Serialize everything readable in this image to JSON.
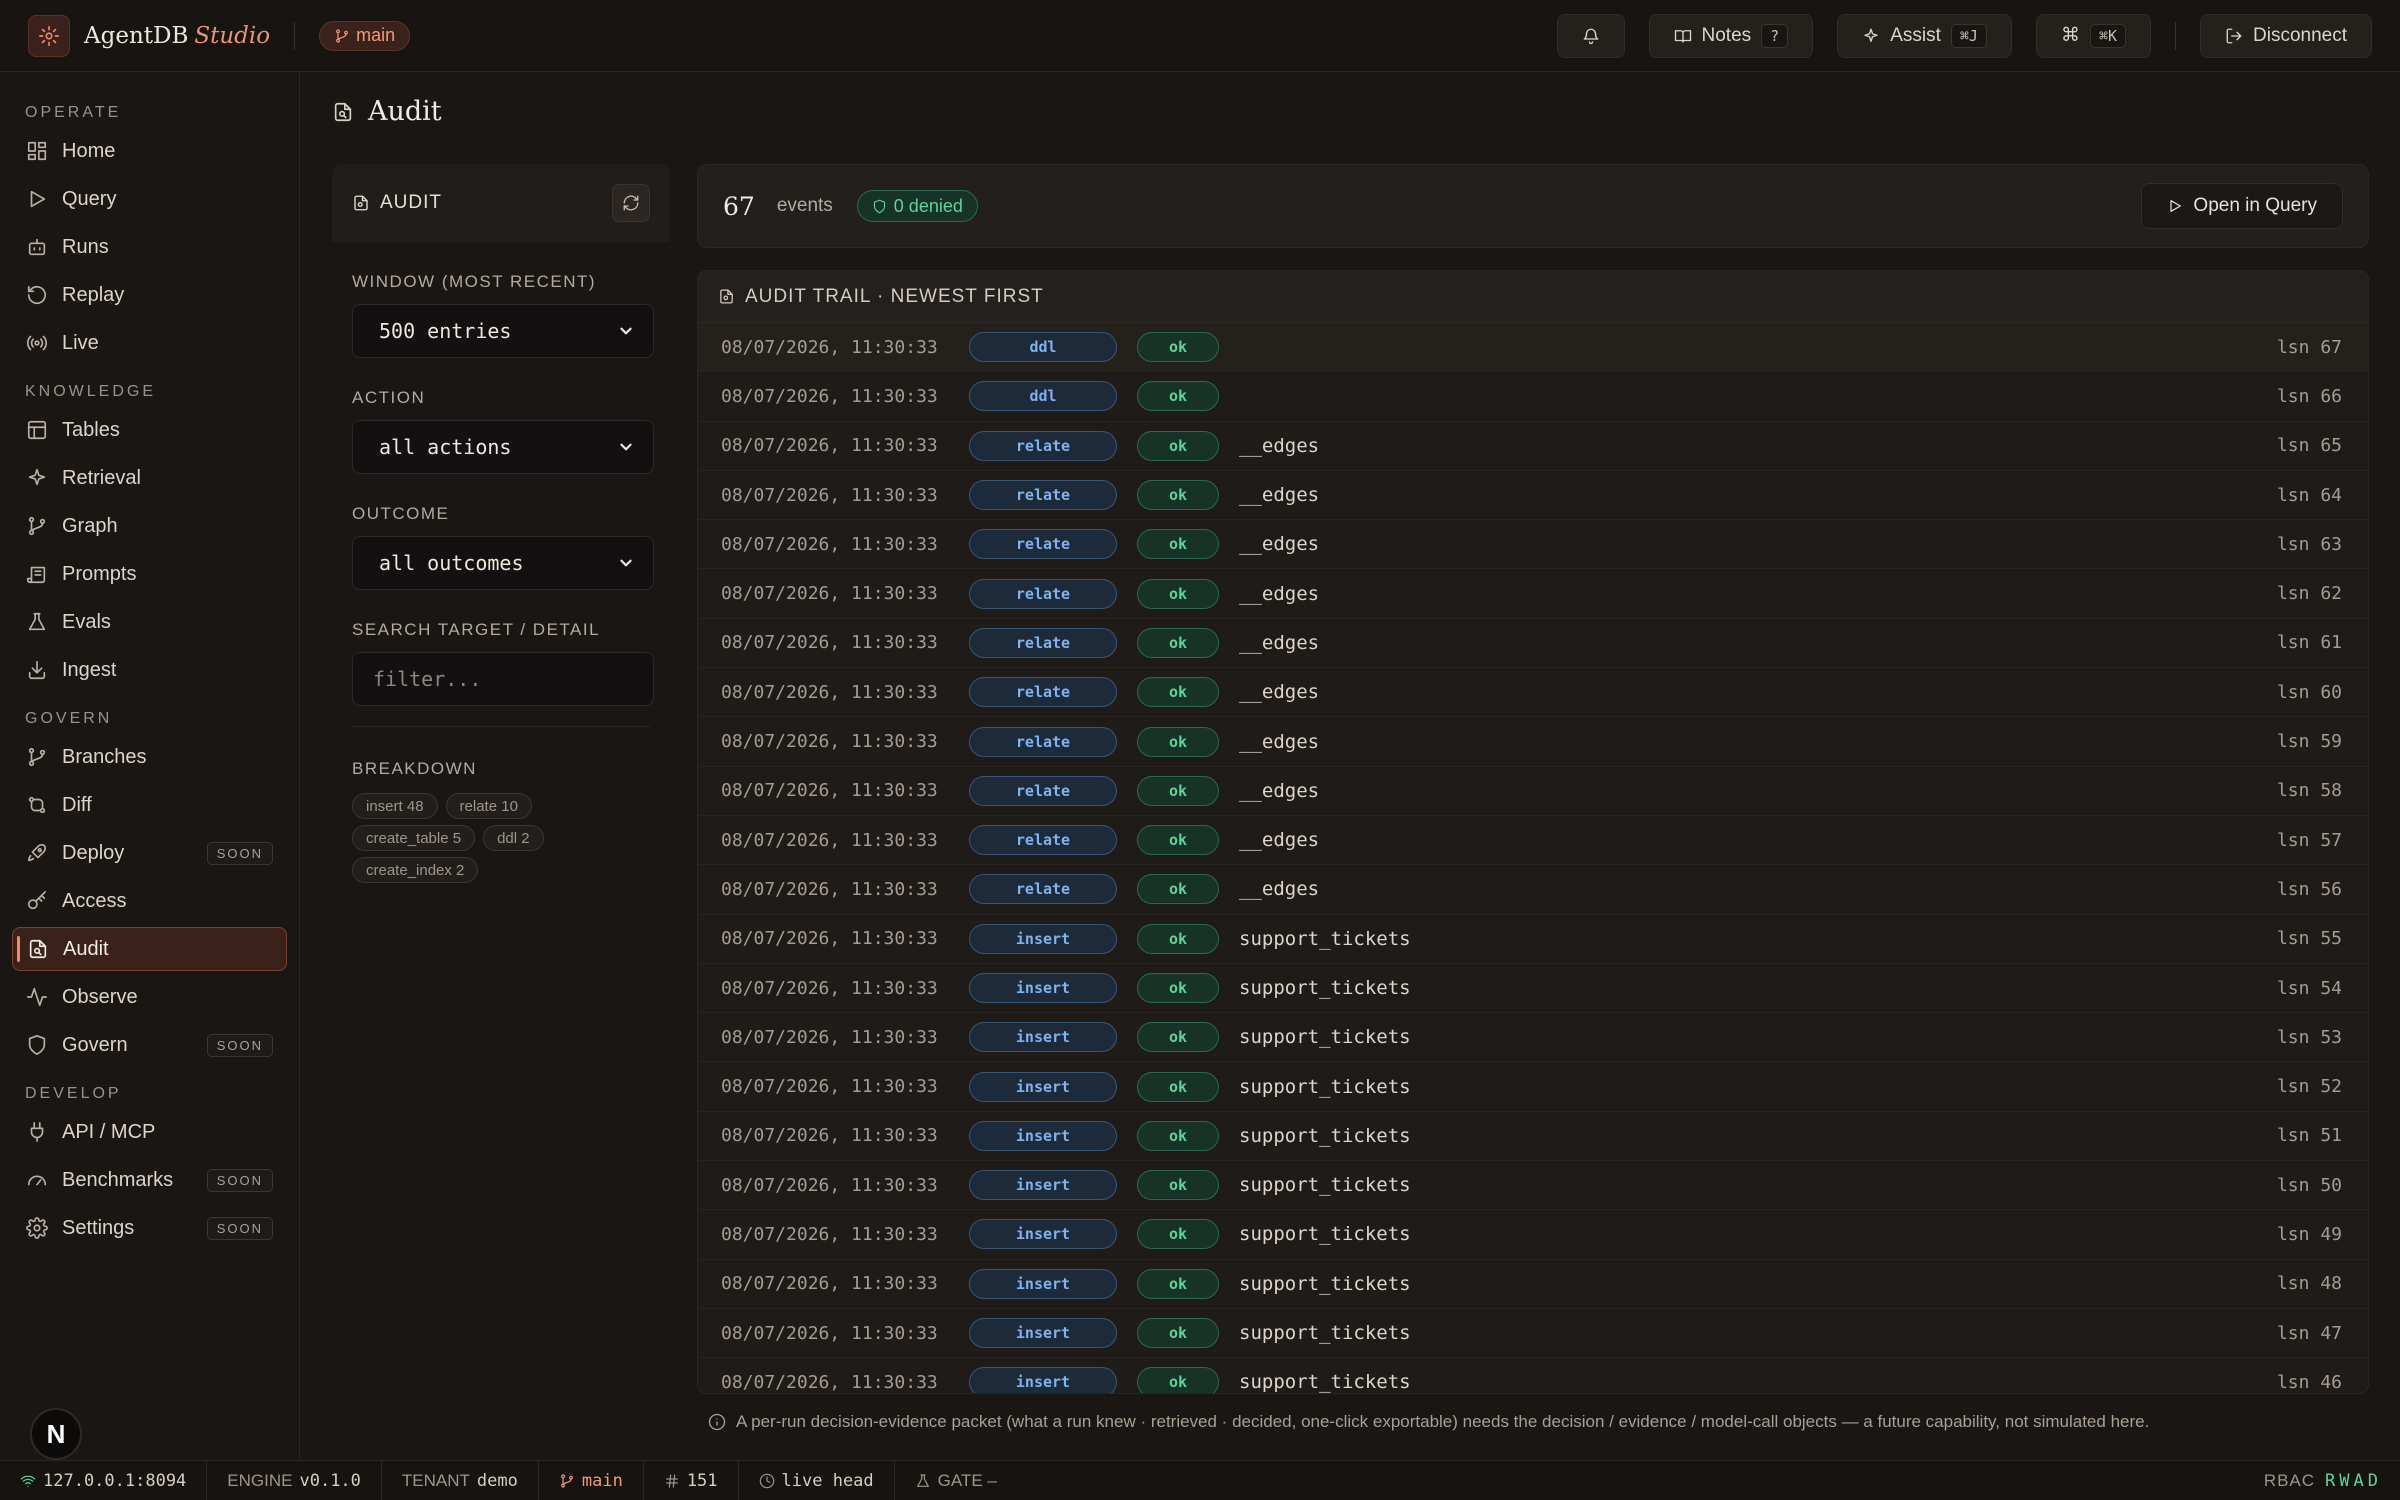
{
  "app": {
    "brand": "AgentDB",
    "brand_suffix": "Studio",
    "branch": "main"
  },
  "topbar": {
    "notes_label": "Notes",
    "notes_key": "?",
    "assist_label": "Assist",
    "assist_key": "⌘J",
    "cmd_symbol": "⌘",
    "cmd_key": "⌘K",
    "disconnect_label": "Disconnect"
  },
  "sidebar": {
    "sections": {
      "operate": "OPERATE",
      "knowledge": "KNOWLEDGE",
      "govern": "GOVERN",
      "develop": "DEVELOP"
    },
    "items": {
      "home": "Home",
      "query": "Query",
      "runs": "Runs",
      "replay": "Replay",
      "live": "Live",
      "tables": "Tables",
      "retrieval": "Retrieval",
      "graph": "Graph",
      "prompts": "Prompts",
      "evals": "Evals",
      "ingest": "Ingest",
      "branches": "Branches",
      "diff": "Diff",
      "deploy": "Deploy",
      "access": "Access",
      "audit": "Audit",
      "observe": "Observe",
      "govern": "Govern",
      "api": "API / MCP",
      "benchmarks": "Benchmarks",
      "settings": "Settings"
    },
    "soon_label": "SOON",
    "avatar_letter": "N"
  },
  "page": {
    "title": "Audit"
  },
  "filters": {
    "panel_title": "AUDIT",
    "window_label": "WINDOW (MOST RECENT)",
    "window_value": "500 entries",
    "action_label": "ACTION",
    "action_value": "all actions",
    "outcome_label": "OUTCOME",
    "outcome_value": "all outcomes",
    "search_label": "SEARCH TARGET / DETAIL",
    "search_placeholder": "filter...",
    "breakdown_label": "BREAKDOWN",
    "breakdown": [
      "insert 48",
      "relate 10",
      "create_table 5",
      "ddl 2",
      "create_index 2"
    ]
  },
  "stats": {
    "count": "67",
    "count_label": "events",
    "denied": "0 denied",
    "open_query": "Open in Query"
  },
  "trail": {
    "title": "AUDIT TRAIL · NEWEST FIRST",
    "rows": [
      {
        "time": "08/07/2026, 11:30:33",
        "action": "ddl",
        "outcome": "ok",
        "target": "",
        "lsn": "lsn 67"
      },
      {
        "time": "08/07/2026, 11:30:33",
        "action": "ddl",
        "outcome": "ok",
        "target": "",
        "lsn": "lsn 66"
      },
      {
        "time": "08/07/2026, 11:30:33",
        "action": "relate",
        "outcome": "ok",
        "target": "__edges",
        "lsn": "lsn 65"
      },
      {
        "time": "08/07/2026, 11:30:33",
        "action": "relate",
        "outcome": "ok",
        "target": "__edges",
        "lsn": "lsn 64"
      },
      {
        "time": "08/07/2026, 11:30:33",
        "action": "relate",
        "outcome": "ok",
        "target": "__edges",
        "lsn": "lsn 63"
      },
      {
        "time": "08/07/2026, 11:30:33",
        "action": "relate",
        "outcome": "ok",
        "target": "__edges",
        "lsn": "lsn 62"
      },
      {
        "time": "08/07/2026, 11:30:33",
        "action": "relate",
        "outcome": "ok",
        "target": "__edges",
        "lsn": "lsn 61"
      },
      {
        "time": "08/07/2026, 11:30:33",
        "action": "relate",
        "outcome": "ok",
        "target": "__edges",
        "lsn": "lsn 60"
      },
      {
        "time": "08/07/2026, 11:30:33",
        "action": "relate",
        "outcome": "ok",
        "target": "__edges",
        "lsn": "lsn 59"
      },
      {
        "time": "08/07/2026, 11:30:33",
        "action": "relate",
        "outcome": "ok",
        "target": "__edges",
        "lsn": "lsn 58"
      },
      {
        "time": "08/07/2026, 11:30:33",
        "action": "relate",
        "outcome": "ok",
        "target": "__edges",
        "lsn": "lsn 57"
      },
      {
        "time": "08/07/2026, 11:30:33",
        "action": "relate",
        "outcome": "ok",
        "target": "__edges",
        "lsn": "lsn 56"
      },
      {
        "time": "08/07/2026, 11:30:33",
        "action": "insert",
        "outcome": "ok",
        "target": "support_tickets",
        "lsn": "lsn 55"
      },
      {
        "time": "08/07/2026, 11:30:33",
        "action": "insert",
        "outcome": "ok",
        "target": "support_tickets",
        "lsn": "lsn 54"
      },
      {
        "time": "08/07/2026, 11:30:33",
        "action": "insert",
        "outcome": "ok",
        "target": "support_tickets",
        "lsn": "lsn 53"
      },
      {
        "time": "08/07/2026, 11:30:33",
        "action": "insert",
        "outcome": "ok",
        "target": "support_tickets",
        "lsn": "lsn 52"
      },
      {
        "time": "08/07/2026, 11:30:33",
        "action": "insert",
        "outcome": "ok",
        "target": "support_tickets",
        "lsn": "lsn 51"
      },
      {
        "time": "08/07/2026, 11:30:33",
        "action": "insert",
        "outcome": "ok",
        "target": "support_tickets",
        "lsn": "lsn 50"
      },
      {
        "time": "08/07/2026, 11:30:33",
        "action": "insert",
        "outcome": "ok",
        "target": "support_tickets",
        "lsn": "lsn 49"
      },
      {
        "time": "08/07/2026, 11:30:33",
        "action": "insert",
        "outcome": "ok",
        "target": "support_tickets",
        "lsn": "lsn 48"
      },
      {
        "time": "08/07/2026, 11:30:33",
        "action": "insert",
        "outcome": "ok",
        "target": "support_tickets",
        "lsn": "lsn 47"
      },
      {
        "time": "08/07/2026, 11:30:33",
        "action": "insert",
        "outcome": "ok",
        "target": "support_tickets",
        "lsn": "lsn 46"
      }
    ]
  },
  "footnote": "A per-run decision-evidence packet (what a run knew · retrieved · decided, one-click exportable) needs the decision / evidence / model-call objects — a future capability, not simulated here.",
  "statusbar": {
    "host": "127.0.0.1:8094",
    "engine_label": "ENGINE",
    "engine_value": "v0.1.0",
    "tenant_label": "TENANT",
    "tenant_value": "demo",
    "branch": "main",
    "lsn_value": "151",
    "head": "live head",
    "gate": "GATE –",
    "rbac_label": "RBAC",
    "rbac_perms": "RWAD"
  }
}
